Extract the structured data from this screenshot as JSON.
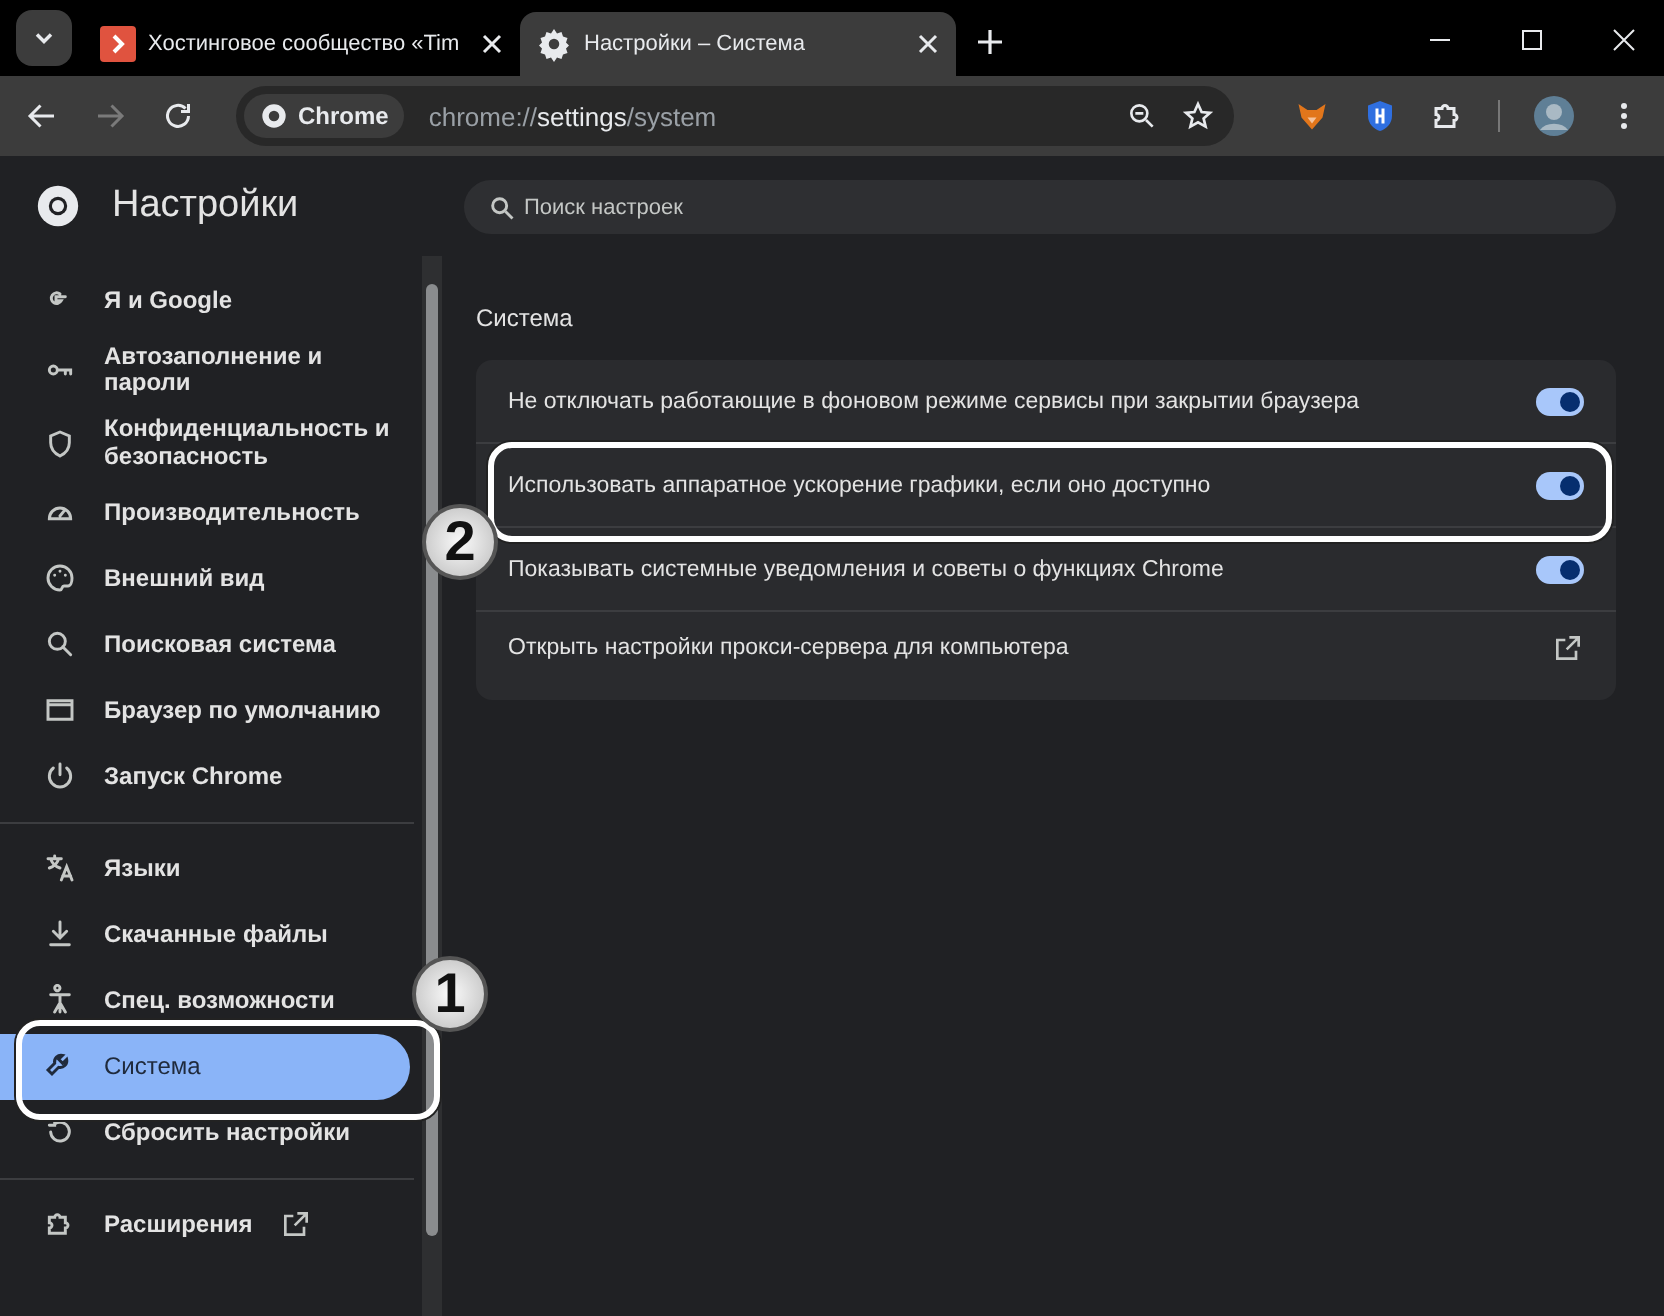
{
  "tabs": [
    {
      "title": "Хостинговое сообщество «Tim",
      "selected": false
    },
    {
      "title": "Настройки – Система",
      "selected": true
    }
  ],
  "toolbar": {
    "forward_disabled": true,
    "chip": "Chrome",
    "url": "chrome://**settings**/system"
  },
  "sidebar": {
    "title": "Настройки",
    "groups": [
      {
        "items": [
          {
            "label": "Я и Google",
            "selected": false
          },
          {
            "label": "Автозаполнение и пароли",
            "selected": false
          },
          {
            "label": "Конфиденциальность и безопасность",
            "selected": false
          },
          {
            "label": "Производительность",
            "selected": false
          },
          {
            "label": "Внешний вид",
            "selected": false
          },
          {
            "label": "Поисковая система",
            "selected": false
          },
          {
            "label": "Браузер по умолчанию",
            "selected": false
          },
          {
            "label": "Запуск Chrome",
            "selected": false
          }
        ]
      },
      {
        "items": [
          {
            "label": "Языки",
            "selected": false
          },
          {
            "label": "Скачанные файлы",
            "selected": false
          },
          {
            "label": "Спец. возможности",
            "selected": false
          },
          {
            "label": "Система",
            "selected": true
          },
          {
            "label": "Сбросить настройки",
            "selected": false
          }
        ]
      },
      {
        "items": [
          {
            "label": "Расширения",
            "selected": false
          }
        ]
      }
    ]
  },
  "search": {
    "placeholder": "Поиск настроек"
  },
  "section": {
    "title": "Система",
    "rows": [
      {
        "kind": "toggle",
        "label": "Не отключать работающие в фоновом режиме сервисы при закрытии браузера",
        "on": true
      },
      {
        "kind": "toggle",
        "label": "Использовать аппаратное ускорение графики, если оно доступно",
        "on": true
      },
      {
        "kind": "toggle",
        "label": "Показывать системные уведомления и советы о функциях Chrome",
        "on": true
      },
      {
        "kind": "link",
        "label": "Открыть настройки прокси-сервера для компьютера"
      }
    ]
  },
  "annotations": [
    {
      "label": "2"
    },
    {
      "label": "1"
    }
  ]
}
